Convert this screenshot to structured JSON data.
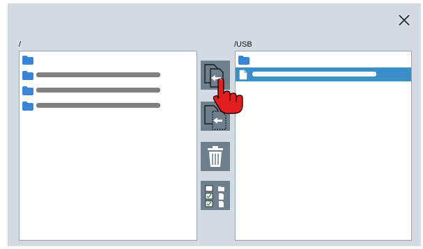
{
  "dialog": {
    "close_icon": "close-icon"
  },
  "left_pane": {
    "path": "/",
    "items": [
      {
        "type": "folder",
        "name": "",
        "icon": "folder-icon"
      },
      {
        "type": "folder",
        "name": "",
        "icon": "folder-icon"
      },
      {
        "type": "folder",
        "name": "",
        "icon": "folder-icon"
      },
      {
        "type": "folder",
        "name": "",
        "icon": "folder-icon"
      }
    ]
  },
  "right_pane": {
    "path": "/USB",
    "items": [
      {
        "type": "folder",
        "name": "",
        "icon": "folder-icon"
      },
      {
        "type": "file",
        "name": "",
        "icon": "file-icon",
        "selected": true
      }
    ]
  },
  "toolbar": {
    "buttons": [
      {
        "id": "copy-to-left",
        "icon": "copy-to-left-icon"
      },
      {
        "id": "copy-to-right",
        "icon": "copy-to-right-icon"
      },
      {
        "id": "delete",
        "icon": "trash-icon"
      },
      {
        "id": "select",
        "icon": "checklist-icon"
      }
    ]
  },
  "colors": {
    "dialog_bg": "#d2dce2",
    "button_bg": "#6f808c",
    "selection": "#3a8fc9",
    "folder": "#3a84d6",
    "name_placeholder": "#808080",
    "hand": "#e01e1e"
  }
}
